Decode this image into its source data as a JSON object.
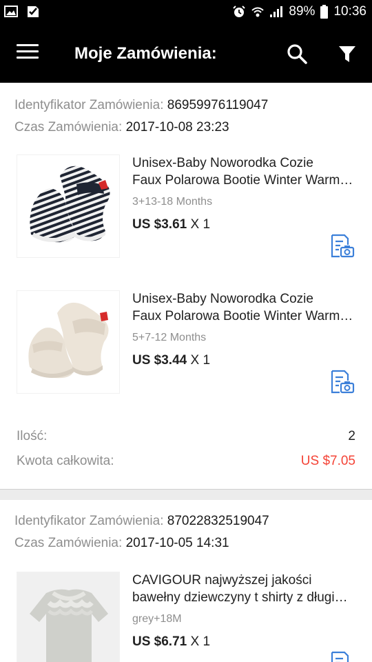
{
  "status_bar": {
    "icons_left": [
      "image-icon",
      "checklist-icon"
    ],
    "icons_right": [
      "alarm-icon",
      "wifi-icon",
      "signal-icon",
      "battery-icon"
    ],
    "battery": "89%",
    "time": "10:36"
  },
  "app_bar": {
    "title": "Moje Zamówienia:",
    "icons": [
      "menu-icon",
      "search-icon",
      "filter-icon"
    ]
  },
  "orders": [
    {
      "id_label": "Identyfikator Zamówienia:",
      "id_value": "86959976119047",
      "time_label": "Czas Zamówienia:",
      "time_value": "2017-10-08 23:23",
      "items": [
        {
          "title_line1": "Unisex-Baby Noworodka Cozie",
          "title_line2": "Faux Polarowa Bootie Winter Warm Boots",
          "variant": "3+13-18 Months",
          "price": "US $3.61",
          "qty": "X 1"
        },
        {
          "title_line1": "Unisex-Baby Noworodka Cozie",
          "title_line2": "Faux Polarowa Bootie Winter Warm Boots",
          "variant": "5+7-12 Months",
          "price": "US $3.44",
          "qty": "X 1"
        }
      ],
      "quantity_label": "Ilość:",
      "quantity_value": "2",
      "total_label": "Kwota całkowita:",
      "total_value": "US $7.05"
    },
    {
      "id_label": "Identyfikator Zamówienia:",
      "id_value": "87022832519047",
      "time_label": "Czas Zamówienia:",
      "time_value": "2017-10-05 14:31",
      "items": [
        {
          "title_line1": "CAVIGOUR najwyższej jakości",
          "title_line2": "bawełny dziewczyny t shirty z długim rękawem",
          "variant": "grey+18M",
          "price": "US $6.71",
          "qty": "X 1"
        }
      ]
    }
  ],
  "colors": {
    "app_bar": "#000000",
    "total_price": "#f44336",
    "label_gray": "#8e8e8e",
    "photo_icon_blue": "#3b7fd9"
  }
}
